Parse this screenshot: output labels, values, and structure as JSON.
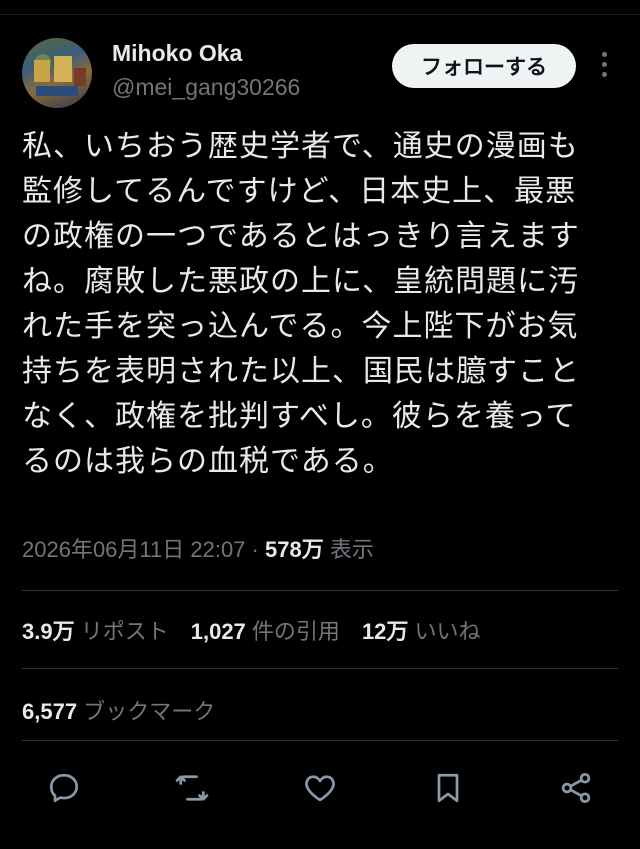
{
  "author": {
    "display_name": "Mihoko Oka",
    "handle": "@mei_gang30266"
  },
  "follow_label": "フォローする",
  "tweet": {
    "lines": [
      "私、いちおう歴史学者で、通史の漫画も",
      "監修してるんですけど、日本史上、最悪",
      "の政権の一つであるとはっきり言えます",
      "ね。腐敗した悪政の上に、皇統問題に汚",
      "れた手を突っ込んでる。今上陛下がお気",
      "持ちを表明された以上、国民は臆すこと",
      "なく、政権を批判すべし。彼らを養って",
      "るのは我らの血税である。"
    ]
  },
  "meta": {
    "timestamp": "2026年06月11日 22:07",
    "separator": "·",
    "views_count": "578万",
    "views_label": "表示"
  },
  "stats": {
    "reposts_count": "3.9万",
    "reposts_label": "リポスト",
    "quotes_count": "1,027",
    "quotes_label": "件の引用",
    "likes_count": "12万",
    "likes_label": "いいね"
  },
  "bookmarks": {
    "count": "6,577",
    "label": "ブックマーク"
  },
  "actions": [
    "reply-icon",
    "repost-icon",
    "like-icon",
    "bookmark-icon",
    "share-icon"
  ],
  "colors": {
    "background": "#000000",
    "text": "#e7e9ea",
    "secondary": "#71767b",
    "divider": "#2f3336",
    "follow_button": "#eff3f4"
  }
}
